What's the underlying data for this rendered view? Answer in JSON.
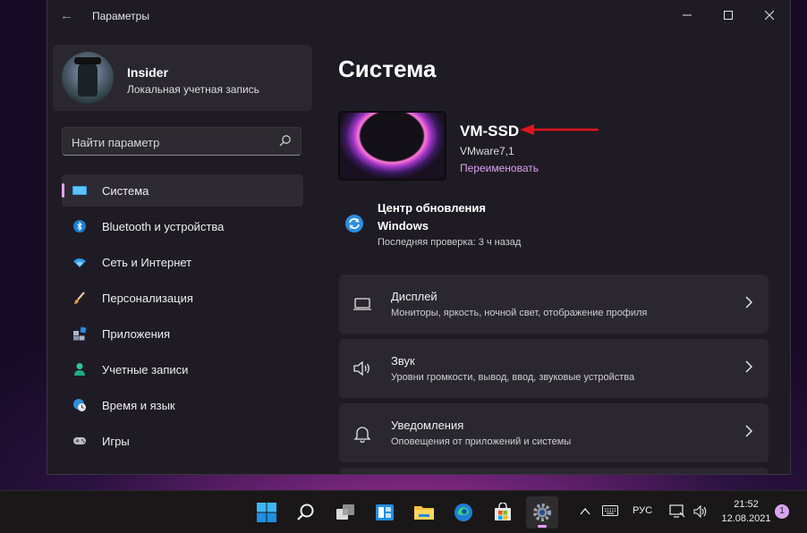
{
  "window": {
    "title": "Параметры"
  },
  "profile": {
    "name": "Insider",
    "account_type": "Локальная учетная запись"
  },
  "search": {
    "placeholder": "Найти параметр"
  },
  "nav": {
    "items": [
      {
        "label": "Система",
        "icon": "system-icon",
        "active": true
      },
      {
        "label": "Bluetooth и устройства",
        "icon": "bluetooth-icon"
      },
      {
        "label": "Сеть и Интернет",
        "icon": "wifi-icon"
      },
      {
        "label": "Персонализация",
        "icon": "brush-icon"
      },
      {
        "label": "Приложения",
        "icon": "apps-icon"
      },
      {
        "label": "Учетные записи",
        "icon": "person-icon"
      },
      {
        "label": "Время и язык",
        "icon": "globe-clock-icon"
      },
      {
        "label": "Игры",
        "icon": "gamepad-icon"
      }
    ]
  },
  "main": {
    "title": "Система",
    "device": {
      "name": "VM-SSD",
      "model": "VMware7,1",
      "rename_label": "Переименовать"
    },
    "update": {
      "title": "Центр обновления Windows",
      "subtitle": "Последняя проверка: 3 ч назад"
    },
    "cards": [
      {
        "title": "Дисплей",
        "subtitle": "Мониторы, яркость, ночной свет, отображение профиля",
        "icon": "monitor-icon"
      },
      {
        "title": "Звук",
        "subtitle": "Уровни громкости, вывод, ввод, звуковые устройства",
        "icon": "speaker-icon"
      },
      {
        "title": "Уведомления",
        "subtitle": "Оповещения от приложений и системы",
        "icon": "bell-icon"
      }
    ]
  },
  "taskbar": {
    "language": "РУС",
    "time": "21:52",
    "date": "12.08.2021",
    "notification_count": "1"
  },
  "colors": {
    "accent": "#e4a3f5",
    "arrow": "#e0141e",
    "card_bg": "#2b2730",
    "window_bg": "#1f1b24"
  }
}
